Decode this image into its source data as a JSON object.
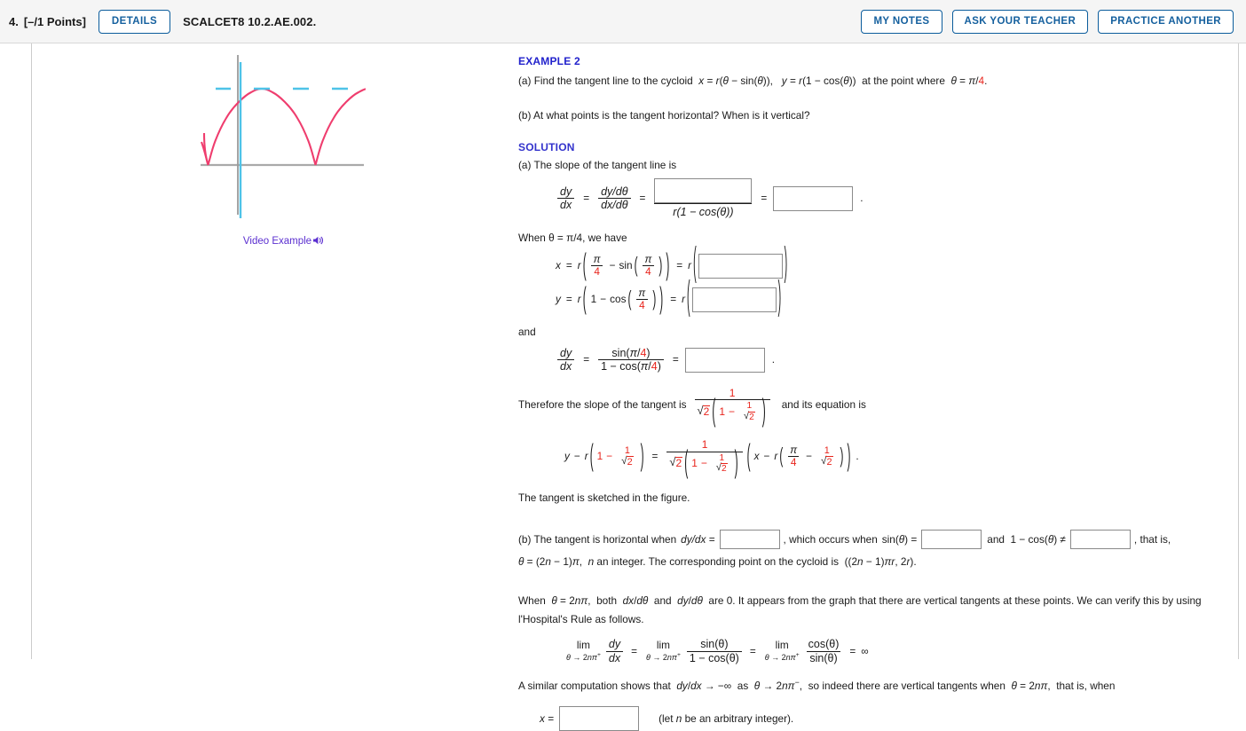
{
  "header": {
    "question_number": "4.",
    "points": "[–/1 Points]",
    "details_label": "DETAILS",
    "problem_code": "SCALCET8 10.2.AE.002.",
    "my_notes_label": "MY NOTES",
    "ask_teacher_label": "ASK YOUR TEACHER",
    "practice_another_label": "PRACTICE ANOTHER",
    "accent_color": "#15609e"
  },
  "figure": {
    "video_example_label": "Video Example",
    "speaker_icon": "speaker-icon",
    "curve_color": "#ef3d6e",
    "tangent_color": "#4ec3e8",
    "axis_color": "#aaaaaa"
  },
  "content": {
    "example_heading": "EXAMPLE 2",
    "part_a_question": "(a) Find the tangent line to the cycloid  x = r(θ − sin(θ)),   y = r(1 − cos(θ))  at the point where  θ = π/4.",
    "part_b_question": "(b) At what points is the tangent horizontal? When is it vertical?",
    "solution_heading": "SOLUTION",
    "part_a_intro": "(a) The slope of the tangent line is",
    "slope_lhs_num": "dy",
    "slope_lhs_den": "dx",
    "slope_mid_num": "dy/dθ",
    "slope_mid_den": "dx/dθ",
    "slope_denominator": "r(1 − cos(θ))",
    "when_theta": "When  θ = π/4,  we have",
    "x_label": "x",
    "y_label": "y",
    "r_label": "r",
    "pi_symbol": "π",
    "four": "4",
    "one": "1",
    "two": "2",
    "sin_label": "sin",
    "cos_label": "cos",
    "and_word": "and",
    "dydx_num": "dy",
    "dydx_den": "dx",
    "sin_pi4": "sin(π/4)",
    "one_minus_cos_pi4": "1 − cos(π/4)",
    "therefore_text": "Therefore the slope of the tangent is",
    "and_equation_is": "and its equation is",
    "sketched_text": "The tangent is sketched in the figure.",
    "part_b_line1_a": "(b) The tangent is horizontal when",
    "part_b_dydx": "dy/dx =",
    "part_b_line1_b": ",  which occurs when",
    "part_b_sin": "sin(θ) =",
    "part_b_line1_c": "and  1 − cos(θ) ≠",
    "part_b_line1_d": ",  that is,",
    "part_b_line2": "θ = (2n − 1)π,  n an integer. The corresponding point on the cycloid is  ((2n − 1)πr, 2r).",
    "when_2npi_line1": "When  θ = 2nπ,  both  dx/dθ  and  dy/dθ  are 0. It appears from the graph that there are vertical tangents at these points. We can verify this by using",
    "when_2npi_line2": "l'Hospital's Rule as follows.",
    "lim_label": "lim",
    "lim_sub": "θ → 2nπ",
    "infinity": "∞",
    "sin_theta": "sin(θ)",
    "cos_theta": "cos(θ)",
    "one_minus_cos_theta": "1 − cos(θ)",
    "similar_text": "A similar computation shows that  dy/dx → −∞  as  θ → 2nπ⁻,  so indeed there are vertical tangents when  θ = 2nπ,  that is, when",
    "x_equals": "x =",
    "arbitrary_integer": "(let n be an arbitrary integer)."
  },
  "inputs": {
    "slope_numerator": "",
    "slope_result": "",
    "x_value": "",
    "y_value": "",
    "dydx_value": "",
    "dydx_horizontal": "",
    "sin_value": "",
    "cos_value": "",
    "x_final": ""
  }
}
